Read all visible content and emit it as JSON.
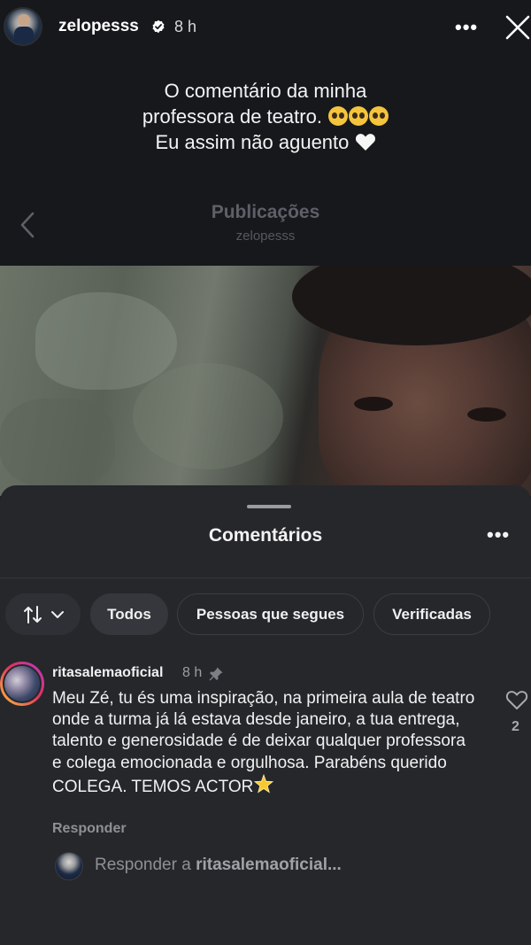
{
  "story": {
    "username": "zelopesss",
    "time": "8 h",
    "caption_line1": "O comentário da minha",
    "caption_line2": "professora de teatro.",
    "caption_line3": "Eu assim não aguento"
  },
  "publications": {
    "title": "Publicações",
    "subtitle": "zelopesss"
  },
  "comments": {
    "title": "Comentários",
    "filters": {
      "all": "Todos",
      "following": "Pessoas que segues",
      "verified": "Verificadas"
    },
    "items": [
      {
        "username": "ritasalemaoficial",
        "time": "8 h",
        "text": "Meu Zé, tu és uma inspiração, na primeira aula de teatro onde a turma já lá estava desde janeiro, a tua entrega, talento e generosidade é de deixar qualquer professora e colega emocionada e orgulhosa. Parabéns querido COLEGA. TEMOS ACTOR",
        "likes": "2",
        "reply_label": "Responder"
      }
    ],
    "reply_prompt": "Responder a ",
    "reply_target": "ritasalemaoficial..."
  },
  "icons": {
    "verified": "verified-badge-icon",
    "more": "more-icon",
    "close": "close-icon",
    "back": "chevron-left-icon",
    "sort": "sort-icon",
    "pin": "pin-icon",
    "like": "heart-icon",
    "star": "star-icon"
  },
  "colors": {
    "sheet_bg": "#25272b",
    "story_bg": "#16181c",
    "muted_text": "#8e9095"
  }
}
